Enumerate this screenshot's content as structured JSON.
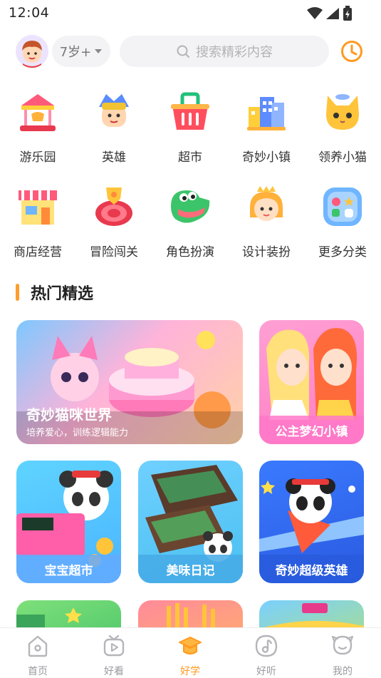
{
  "status": {
    "time": "12:04"
  },
  "top": {
    "age": "7岁+",
    "search_placeholder": "搜索精彩内容"
  },
  "categories": [
    {
      "label": "游乐园",
      "icon": "carousel-icon"
    },
    {
      "label": "英雄",
      "icon": "hero-icon"
    },
    {
      "label": "超市",
      "icon": "basket-icon"
    },
    {
      "label": "奇妙小镇",
      "icon": "town-icon"
    },
    {
      "label": "领养小猫",
      "icon": "cat-icon"
    },
    {
      "label": "商店经营",
      "icon": "shop-icon"
    },
    {
      "label": "冒险闯关",
      "icon": "target-icon"
    },
    {
      "label": "角色扮演",
      "icon": "crocodile-icon"
    },
    {
      "label": "设计装扮",
      "icon": "princess-icon"
    },
    {
      "label": "更多分类",
      "icon": "more-icon"
    }
  ],
  "section": {
    "title": "热门精选"
  },
  "cards": [
    {
      "title": "奇妙猫咪世界",
      "subtitle": "培养爱心，训练逻辑能力"
    },
    {
      "title": "公主梦幻小镇"
    },
    {
      "title": "宝宝超市"
    },
    {
      "title": "美味日记"
    },
    {
      "title": "奇妙超级英雄"
    }
  ],
  "nav": [
    {
      "label": "首页",
      "icon": "home-icon"
    },
    {
      "label": "好看",
      "icon": "tv-icon"
    },
    {
      "label": "好学",
      "icon": "graduation-cap-icon"
    },
    {
      "label": "好听",
      "icon": "music-note-icon"
    },
    {
      "label": "我的",
      "icon": "profile-icon"
    }
  ],
  "colors": {
    "accent": "#ff9a1f",
    "section_bar": "#ff9d2d"
  }
}
